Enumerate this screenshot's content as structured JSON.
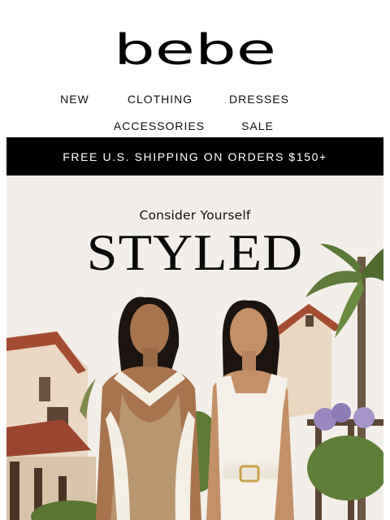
{
  "brand": {
    "logo_text": "bebe"
  },
  "nav": {
    "row1": [
      "NEW",
      "CLOTHING",
      "DRESSES"
    ],
    "row2": [
      "ACCESSORIES",
      "SALE"
    ]
  },
  "banner": {
    "text": "FREE U.S. SHIPPING ON ORDERS $150+"
  },
  "hero": {
    "subtitle": "Consider Yourself",
    "title": "STYLED",
    "image": "two-models-in-dresses-photo"
  },
  "colors": {
    "banner_bg": "#000000",
    "banner_text": "#ffffff",
    "text": "#111111",
    "background": "#ffffff"
  }
}
